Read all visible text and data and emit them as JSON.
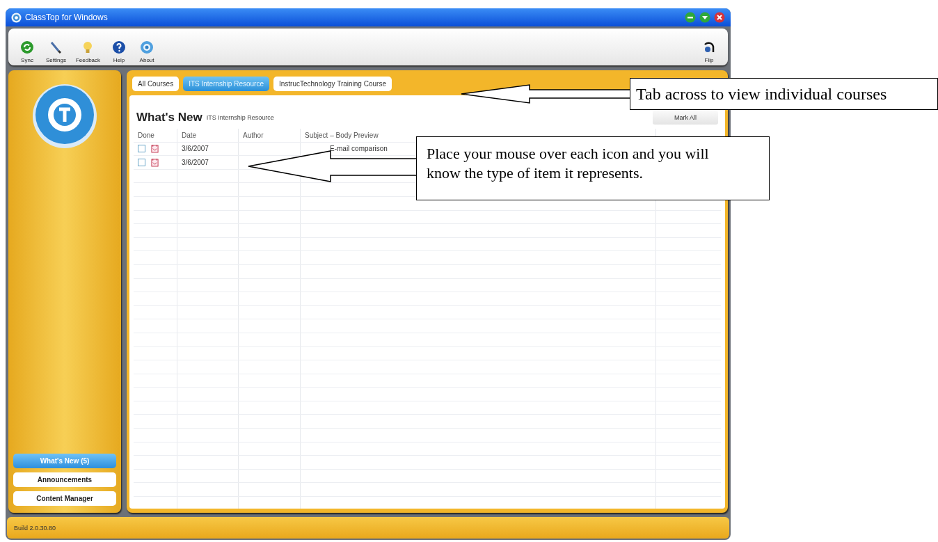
{
  "window": {
    "title": "ClassTop for Windows"
  },
  "toolbar": {
    "items": [
      {
        "label": "Sync",
        "kind": "sync"
      },
      {
        "label": "Settings",
        "kind": "settings"
      },
      {
        "label": "Feedback",
        "kind": "feedback"
      },
      {
        "label": "Help",
        "kind": "help"
      },
      {
        "label": "About",
        "kind": "about"
      }
    ],
    "right": {
      "label": "Flip",
      "kind": "flip"
    }
  },
  "sidebar": {
    "items": [
      {
        "label": "What's New (5)",
        "selected": true
      },
      {
        "label": "Announcements",
        "selected": false
      },
      {
        "label": "Content Manager",
        "selected": false
      }
    ]
  },
  "tabs": [
    {
      "label": "All Courses",
      "selected": false
    },
    {
      "label": "ITS Internship Resource",
      "selected": true
    },
    {
      "label": "InstrucTechnology Training Course",
      "selected": false
    }
  ],
  "content": {
    "title": "What's New",
    "subtitle": "ITS Internship Resource",
    "button": "Mark All"
  },
  "table": {
    "columns": [
      "Done",
      "Date",
      "Author",
      "Subject – Body Preview"
    ],
    "rows": [
      {
        "done": false,
        "date": "3/6/2007",
        "subject": "E-mail comparison"
      },
      {
        "done": false,
        "date": "3/6/2007",
        "subject": ""
      }
    ]
  },
  "status_bar": "Build 2.0.30.80",
  "callouts": [
    {
      "text": "Tab across to view individual courses"
    },
    {
      "text": "Place your mouse over each icon and you will know the type of item it represents."
    }
  ]
}
